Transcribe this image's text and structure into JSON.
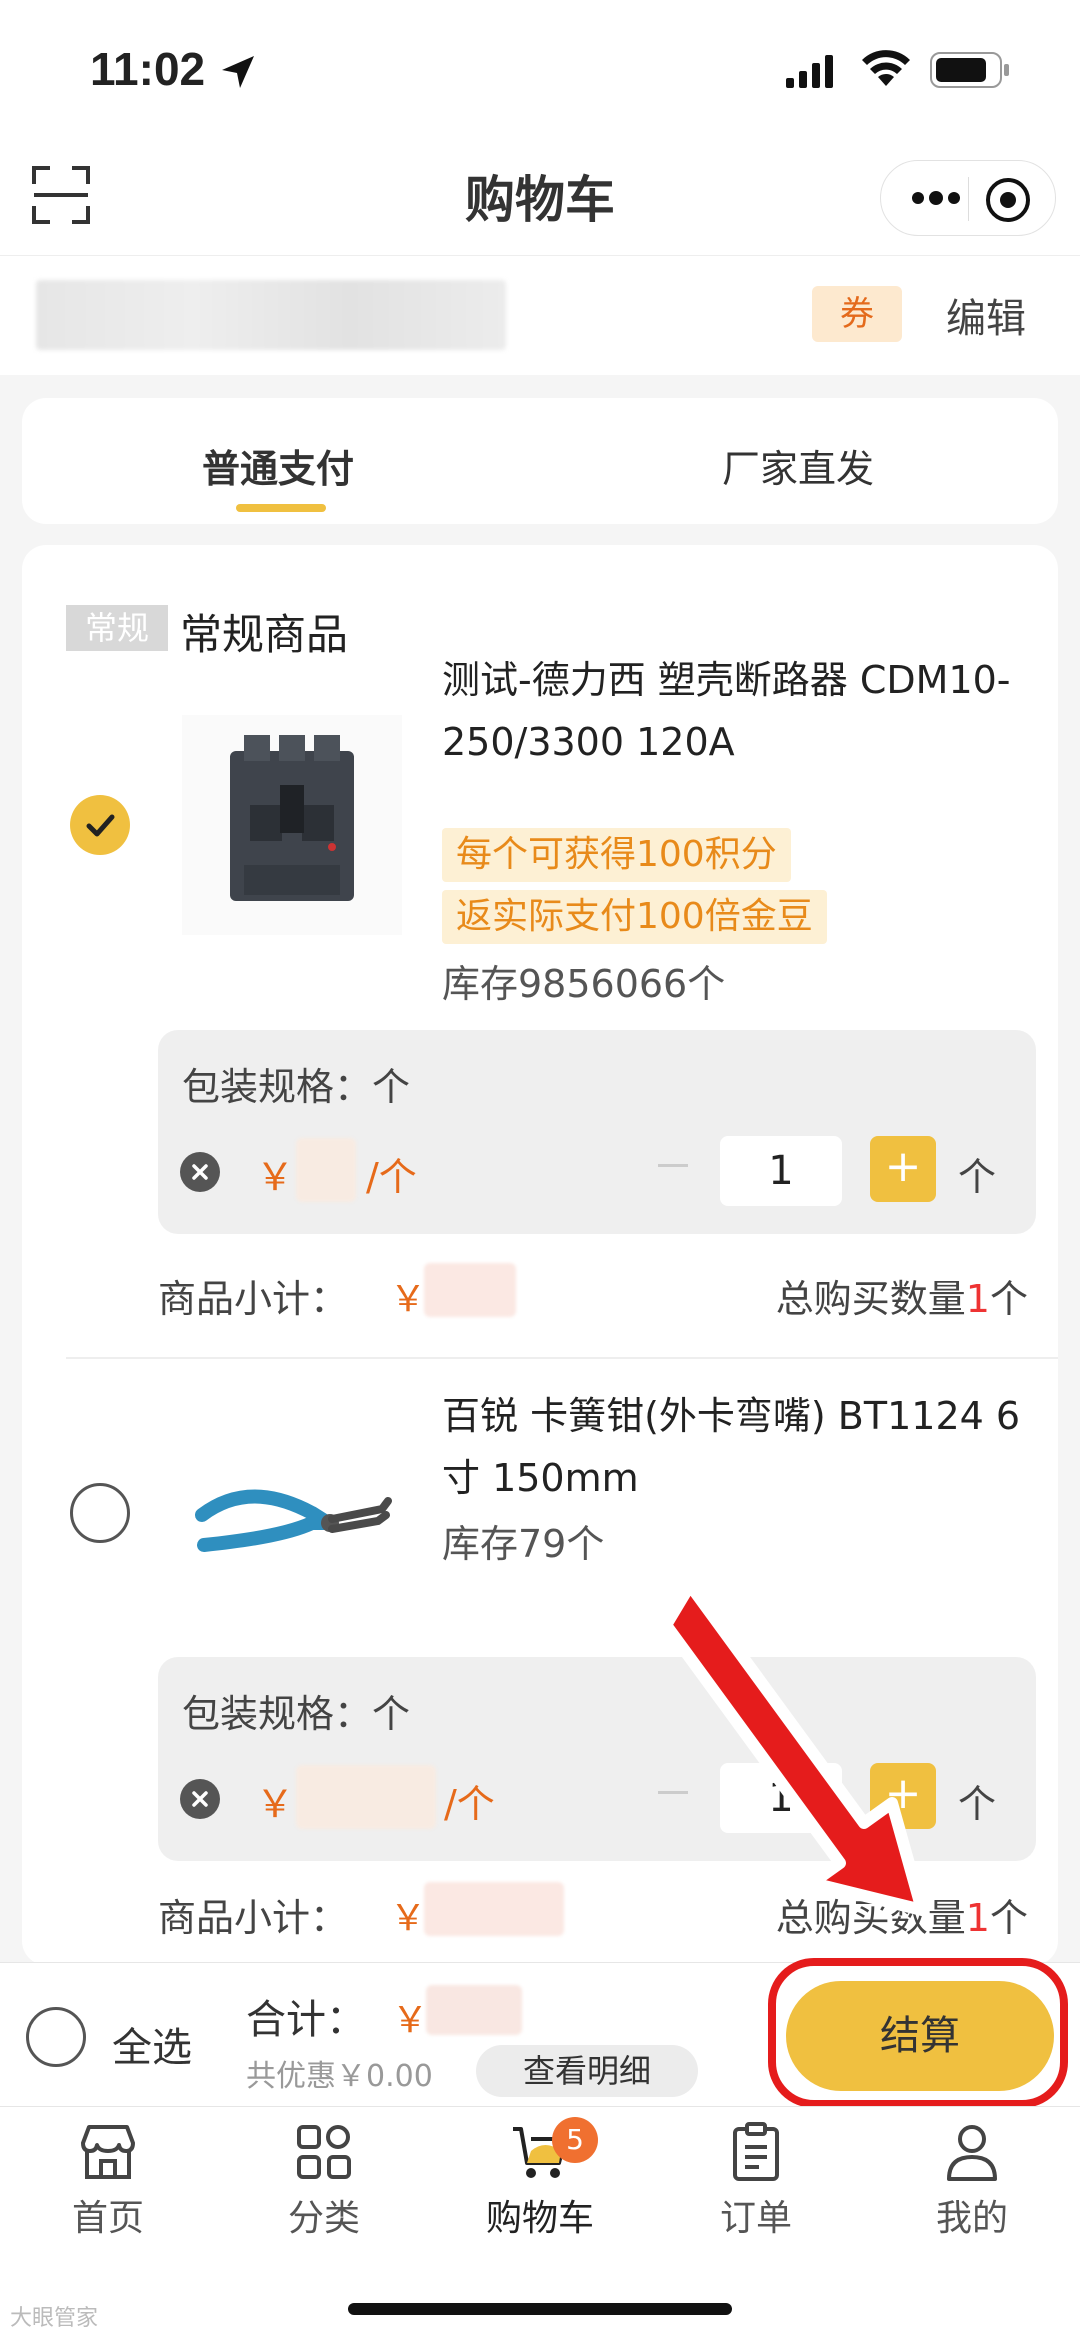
{
  "status_bar": {
    "time": "11:02"
  },
  "nav": {
    "title": "购物车"
  },
  "address": {
    "coupon_label": "券",
    "edit_label": "编辑"
  },
  "tabs": [
    {
      "label": "普通支付",
      "active": true
    },
    {
      "label": "厂家直发",
      "active": false
    }
  ],
  "group": {
    "badge": "常规",
    "title": "常规商品"
  },
  "items": [
    {
      "checked": true,
      "title": "测试-德力西 塑壳断路器 CDM10-250/3300 120A",
      "tags": [
        "每个可获得100积分",
        "返实际支付100倍金豆"
      ],
      "stock": "库存9856066个",
      "spec_label": "包装规格：个",
      "price_prefix": "￥",
      "price_unit": "/个",
      "quantity": "1",
      "plus": "+",
      "qty_unit": "个",
      "subtotal_label": "商品小计：",
      "subtotal_prefix": "￥",
      "total_qty_prefix": "总购买数量",
      "total_qty_value": "1",
      "total_qty_suffix": "个"
    },
    {
      "checked": false,
      "title": "百锐 卡簧钳(外卡弯嘴) BT1124 6寸 150mm",
      "tags": [],
      "stock": "库存79个",
      "spec_label": "包装规格：个",
      "price_prefix": "￥",
      "price_unit": "/个",
      "quantity": "1",
      "plus": "+",
      "qty_unit": "个",
      "subtotal_label": "商品小计：",
      "subtotal_prefix": "￥",
      "total_qty_prefix": "总购买数量",
      "total_qty_value": "1",
      "total_qty_suffix": "个"
    }
  ],
  "settle": {
    "select_all": "全选",
    "total_label": "合计：",
    "total_prefix": "￥",
    "discount": "共优惠￥0.00",
    "detail_button": "查看明细",
    "checkout_button": "结算"
  },
  "tab_bar": [
    {
      "label": "首页",
      "icon": "store-icon"
    },
    {
      "label": "分类",
      "icon": "grid-icon"
    },
    {
      "label": "购物车",
      "icon": "cart-icon",
      "badge": "5"
    },
    {
      "label": "订单",
      "icon": "clipboard-icon"
    },
    {
      "label": "我的",
      "icon": "user-icon"
    }
  ],
  "watermark": "大眼管家",
  "colors": {
    "accent": "#f0c040",
    "price": "#e66a1a",
    "annotation": "#e51c1c"
  }
}
